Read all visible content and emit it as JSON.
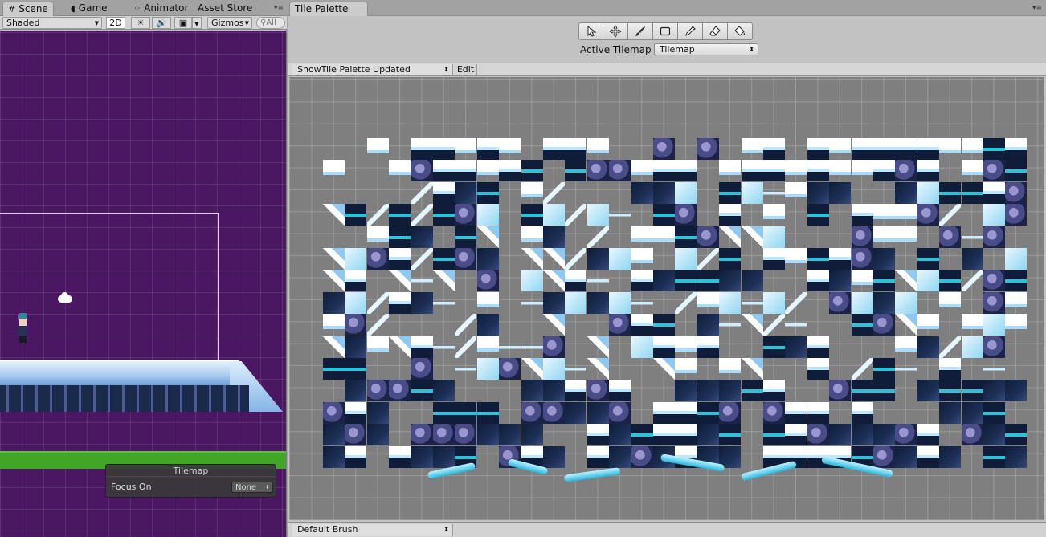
{
  "scene_window": {
    "tabs": [
      {
        "label": "Scene",
        "icon": "grid-icon"
      },
      {
        "label": "Game",
        "icon": "pacman-icon"
      },
      {
        "label": "Animator",
        "icon": "animator-icon"
      },
      {
        "label": "Asset Store",
        "icon": "store-icon"
      }
    ],
    "toolbar": {
      "shading_mode": "Shaded",
      "mode_2d": "2D",
      "gizmos": "Gizmos",
      "search_placeholder": "All"
    },
    "overlay": {
      "title": "Tilemap",
      "focus_label": "Focus On",
      "focus_value": "None"
    }
  },
  "palette_window": {
    "tab_title": "Tile Palette",
    "tools": [
      "select-tool",
      "move-tool",
      "paint-tool",
      "box-fill-tool",
      "picker-tool",
      "erase-tool",
      "fill-tool"
    ],
    "active_tilemap_label": "Active Tilemap",
    "active_tilemap_value": "Tilemap",
    "palette_name": "SnowTile Palette Updated",
    "edit_label": "Edit",
    "brush_name": "Default Brush"
  },
  "colors": {
    "scene_background": "#4b1763",
    "ground_green": "#3fa626",
    "palette_grid": "#7f7f7f",
    "editor_chrome": "#c2c2c2"
  }
}
